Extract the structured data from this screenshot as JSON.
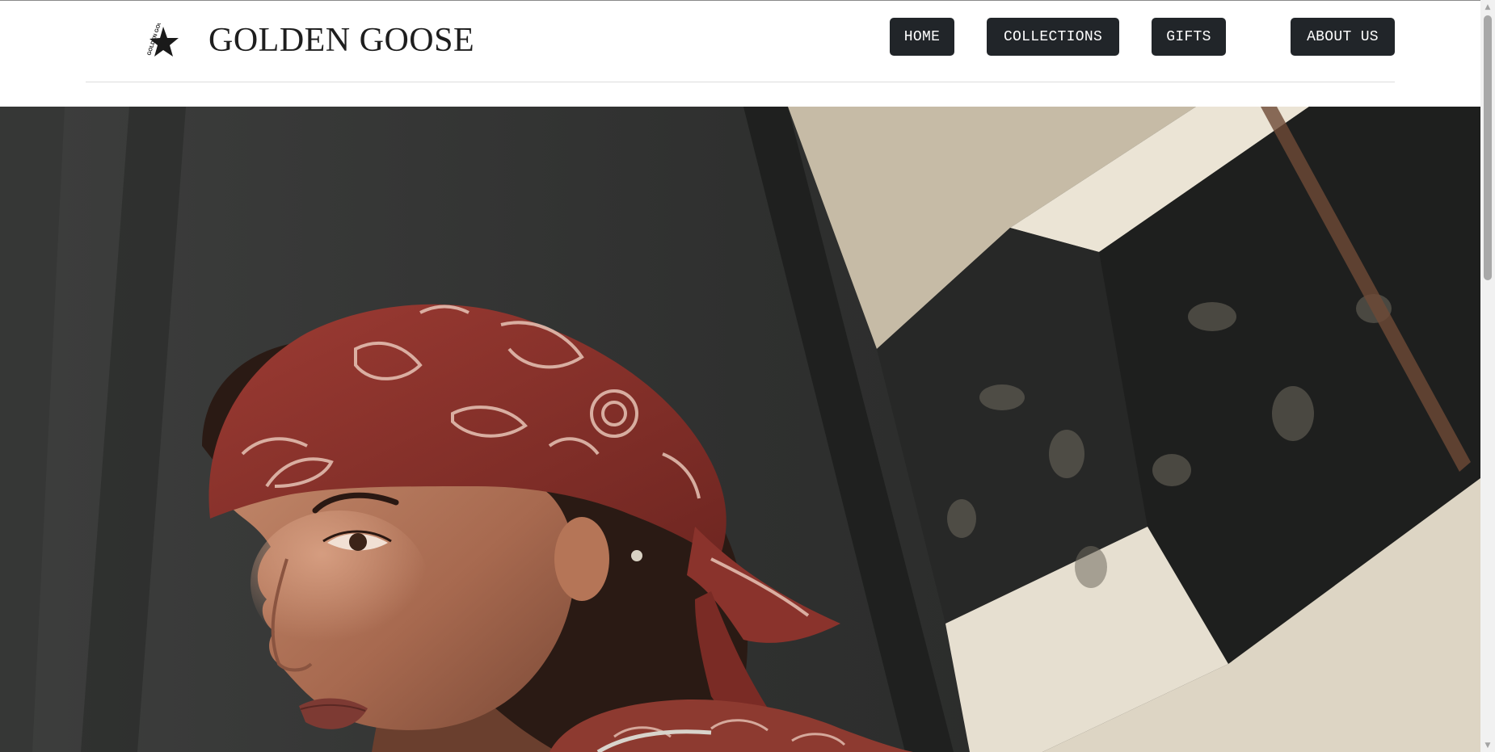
{
  "header": {
    "brand": "GOLDEN GOOSE",
    "logo_text": "GOLDEN GOOSE",
    "logo_icon": "star-icon"
  },
  "nav": {
    "home": "HOME",
    "collections": "COLLECTIONS",
    "gifts": "GIFTS",
    "about": "ABOUT US"
  },
  "hero": {
    "subject": "hero-photo"
  },
  "colors": {
    "nav_button_bg": "#212529",
    "nav_button_text": "#ffffff",
    "brand_text": "#1e1e1e",
    "bandana": "#8c2f28"
  }
}
